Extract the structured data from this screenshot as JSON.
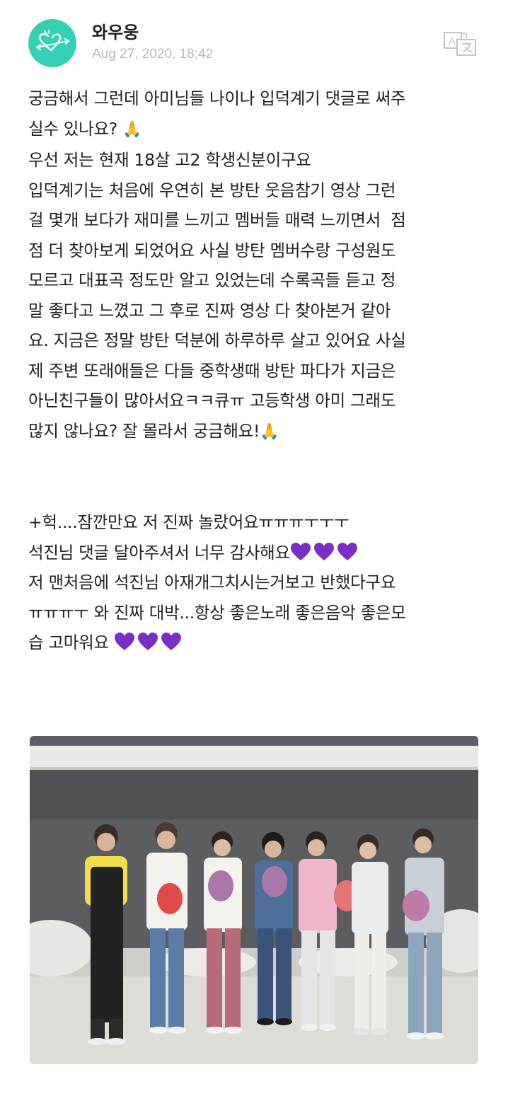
{
  "post": {
    "author": "와우웅",
    "date": "Aug 27, 2020, 18:42",
    "translate_icon": "translate-icon",
    "avatar_icon": "heart-arrow-logo-icon"
  },
  "content": {
    "paragraph1": [
      "궁금해서 그런데 아미님들 나이나 입덕계기 댓글로 써주",
      "실수 있나요? ",
      "우선 저는 현재 18살 고2 학생신분이구요",
      "입덕계기는 처음에 우연히 본 방탄 웃음참기 영상 그런",
      "걸 몇개 보다가 재미를 느끼고 멤버들 매력 느끼면서  점",
      "점 더 찾아보게 되었어요 사실 방탄 멤버수랑 구성원도",
      "모르고 대표곡 정도만 알고 있었는데 수록곡들 듣고 정",
      "말 좋다고 느꼈고 그 후로 진짜 영상 다 찾아본거 같아",
      "요. 지금은 정말 방탄 덕분에 하루하루 살고 있어요 사실",
      "제 주변 또래애들은 다들 중학생때 방탄 파다가 지금은",
      "아닌친구들이 많아서요ㅋㅋ큐ㅠ 고등학생 아미 그래도",
      "많지 않나요? 잘 몰라서 궁금해요!"
    ],
    "paragraph2": [
      "+헉....잠깐만요 저 진짜 놀랐어요ㅠㅠㅠㅜㅜㅜ",
      "석진님 댓글 달아주셔서 너무 감사해요",
      "저 맨처음에 석진님 아재개그치시는거보고 반했다구요",
      "ㅠㅠㅠㅜ 와 진짜 대박...항상 좋은노래 좋은음악 좋은모",
      "습 고마워요 "
    ],
    "pray_emoji": "🙏",
    "heart_color": "#7a2fc4"
  },
  "photo": {
    "description_icon": "group-photo-image"
  }
}
